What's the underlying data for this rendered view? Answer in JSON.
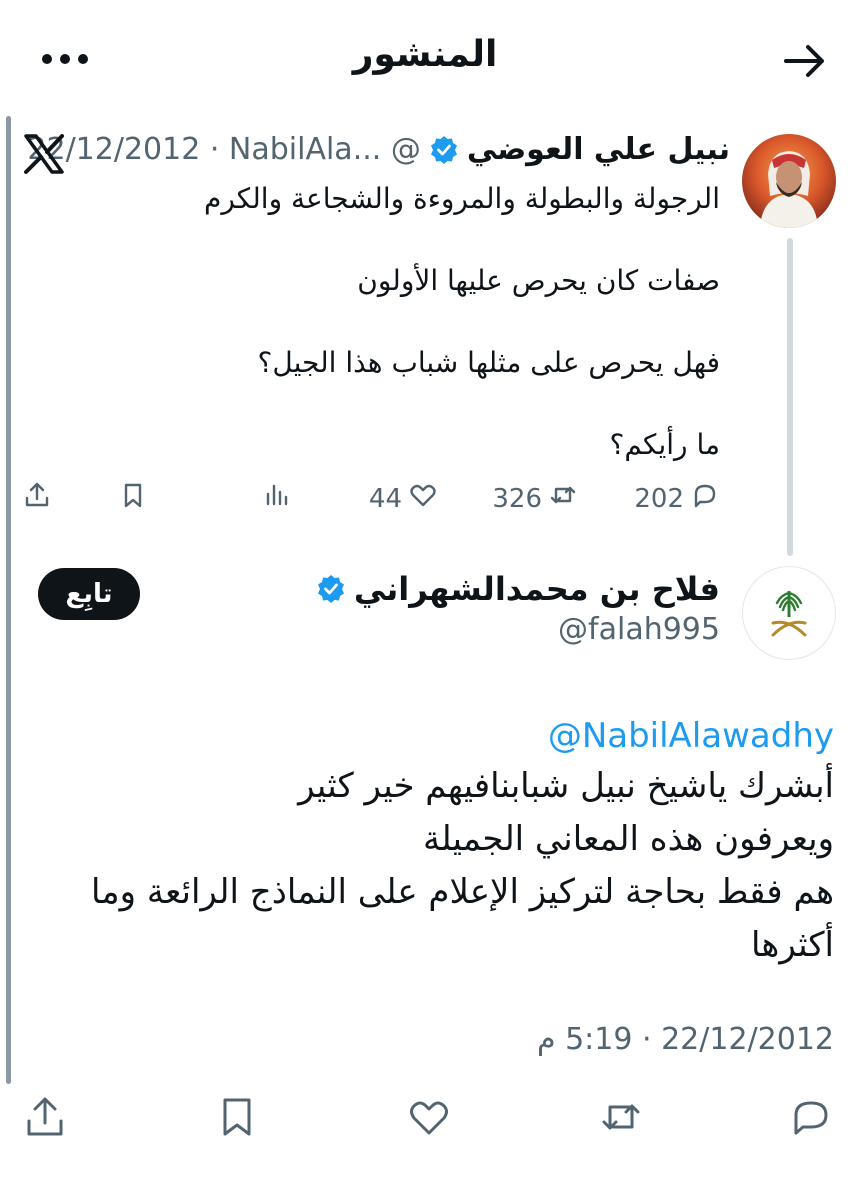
{
  "header": {
    "title": "المنشور",
    "back_icon": "arrow-icon",
    "more_icon": "more-dots-icon"
  },
  "quoted_tweet": {
    "author_name": "نبيل علي العوضي",
    "handle_date": "22/12/2012 · NabilAla... @",
    "text": "الرجولة والبطولة والمروءة والشجاعة والكرم\n\nصفات كان يحرص عليها الأولون\n\nفهل يحرص على مثلها شباب هذا الجيل؟\n\nما رأيكم؟",
    "stats": {
      "replies": "202",
      "retweets": "326",
      "likes": "44"
    }
  },
  "main_tweet": {
    "author_name": "فلاح بن محمدالشهراني",
    "handle": "@falah995",
    "follow_label": "تابِع",
    "mention": "@NabilAlawadhy",
    "text": "أبشرك ياشيخ نبيل شبابنافيهم خير كثير\nويعرفون هذه المعاني الجميلة\nهم فقط بحاجة لتركيز الإعلام على النماذج الرائعة وما\nأكثرها",
    "timestamp": "22/12/2012 · 5:19 م"
  },
  "colors": {
    "verified": "#1d9bf0",
    "link": "#1d9bf0",
    "muted": "#536471",
    "follow_bg": "#0f1419"
  }
}
